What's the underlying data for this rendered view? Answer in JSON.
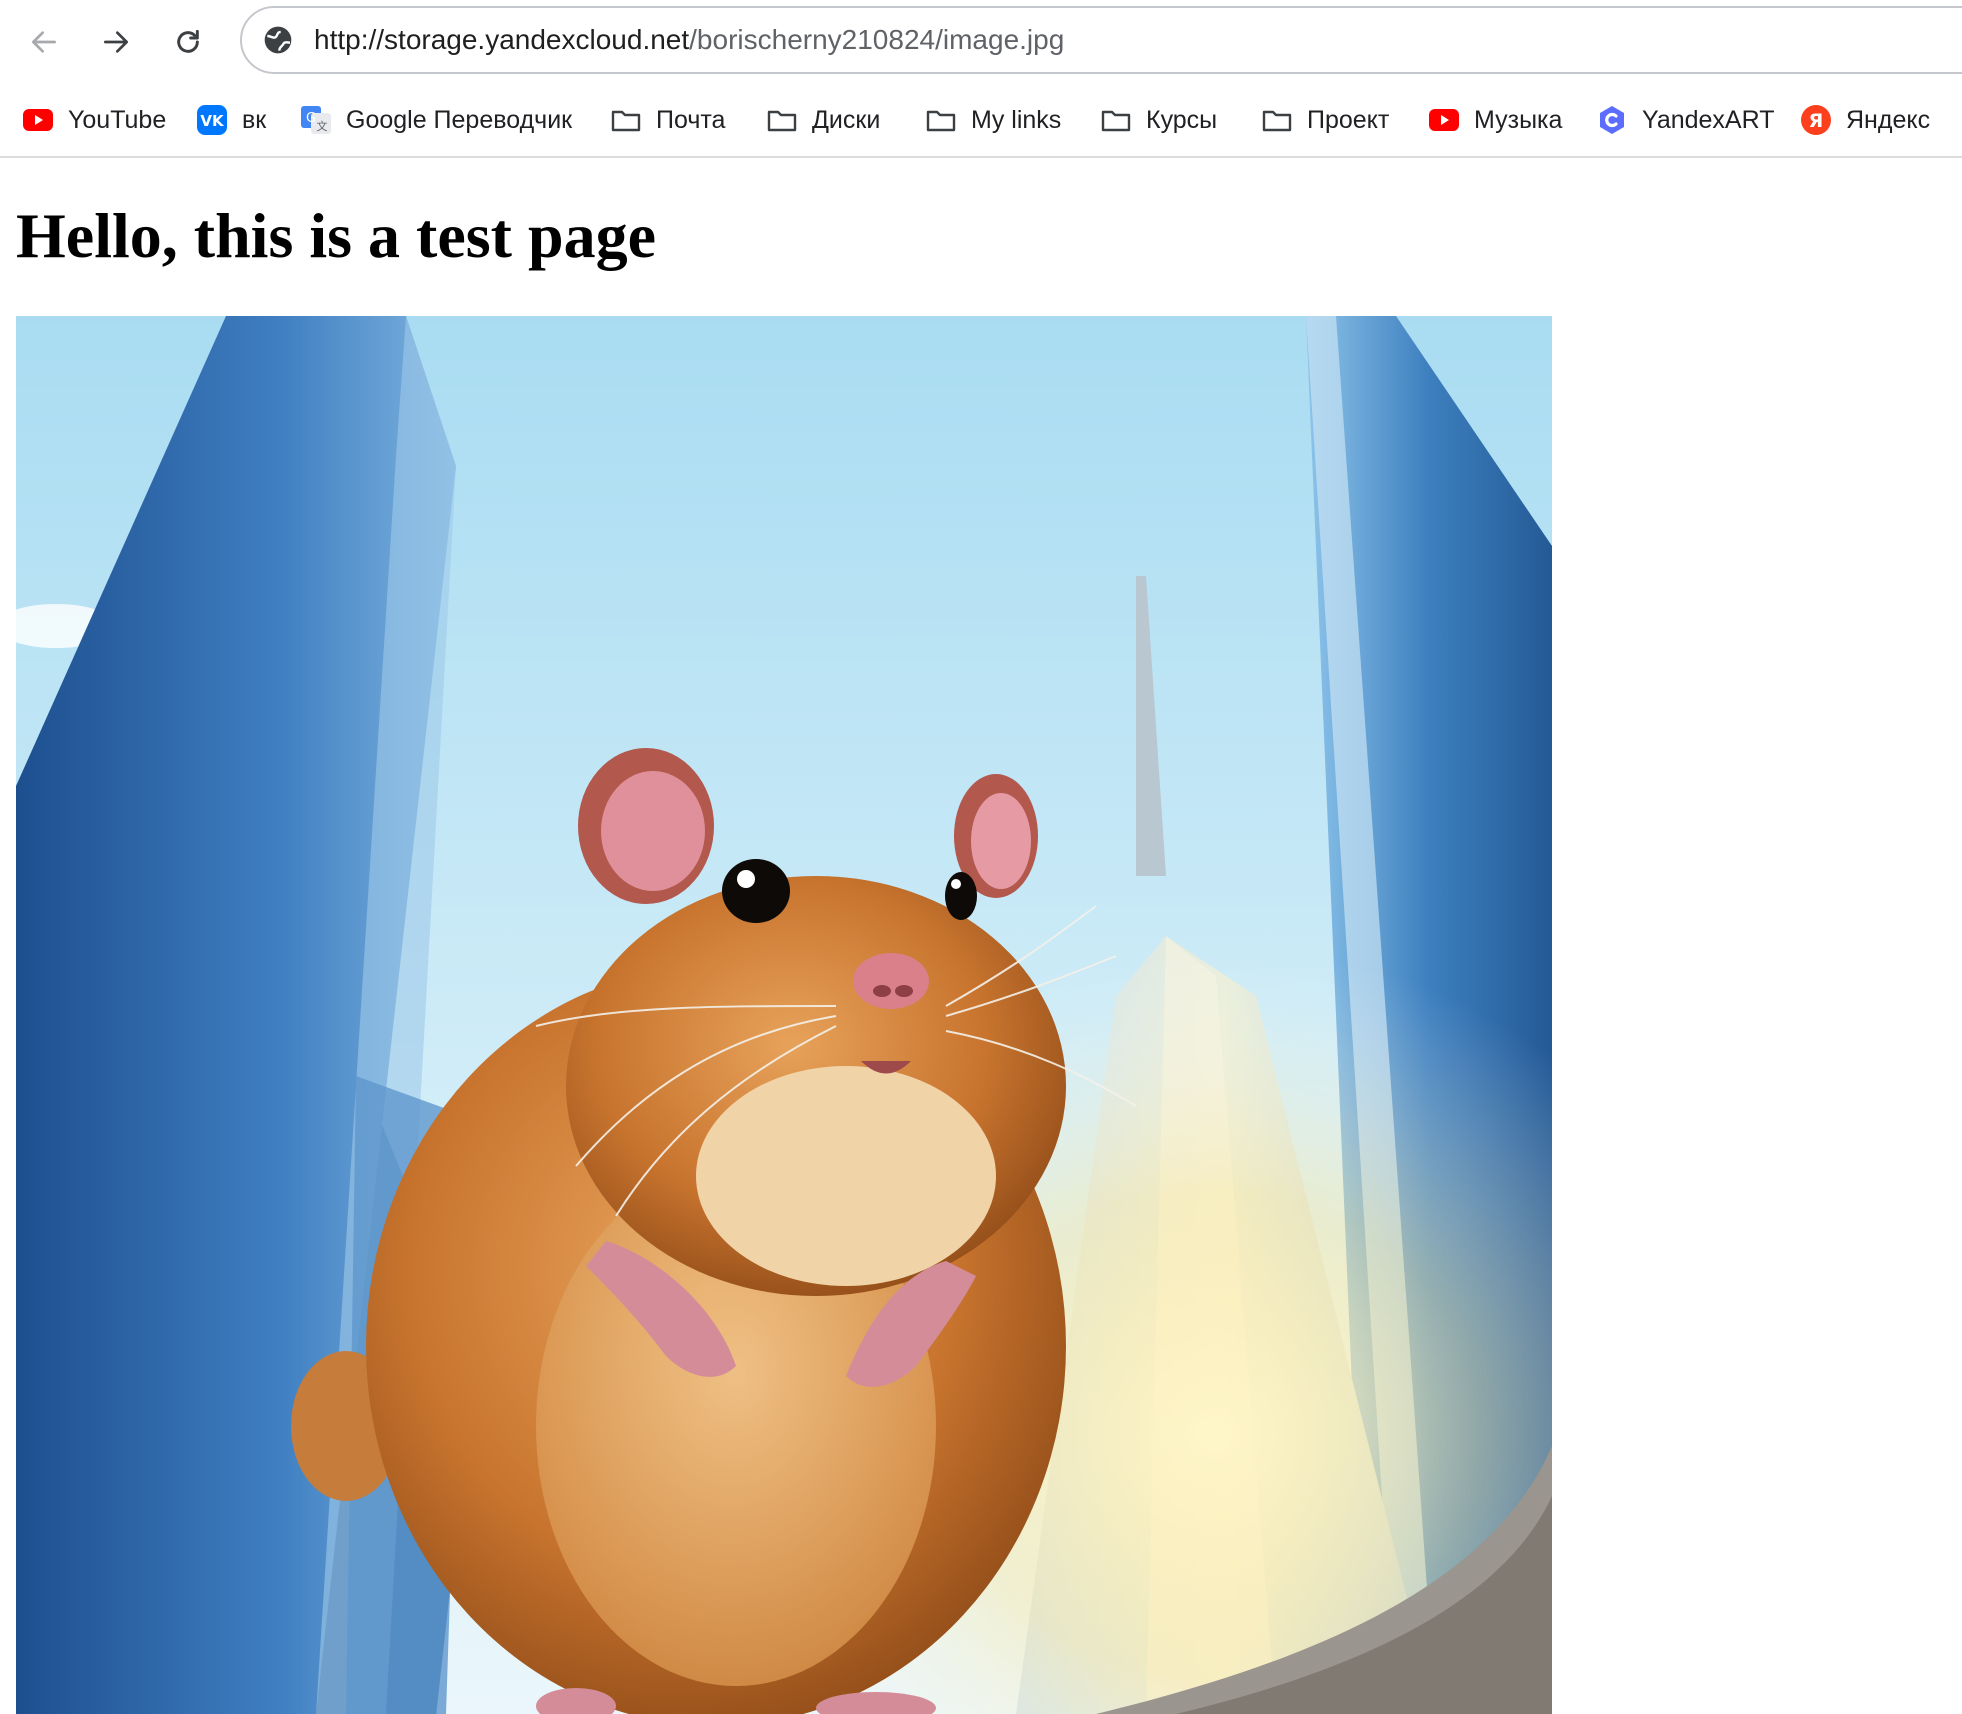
{
  "browser": {
    "url_host": "http://storage.yandexcloud.net",
    "url_path": "/borischerny210824/image.jpg",
    "icons": {
      "back": "arrow-left-icon",
      "forward": "arrow-right-icon",
      "reload": "reload-icon",
      "site": "globe-icon"
    }
  },
  "bookmarks": [
    {
      "label": "YouTube",
      "icon": "youtube-icon"
    },
    {
      "label": "вк",
      "icon": "vk-icon"
    },
    {
      "label": "Google Переводчик",
      "icon": "google-translate-icon"
    },
    {
      "label": "Почта",
      "icon": "folder-icon"
    },
    {
      "label": "Диски",
      "icon": "folder-icon"
    },
    {
      "label": "My links",
      "icon": "folder-icon"
    },
    {
      "label": "Курсы",
      "icon": "folder-icon"
    },
    {
      "label": "Проект",
      "icon": "folder-icon"
    },
    {
      "label": "Музыка",
      "icon": "youtube-icon"
    },
    {
      "label": "YandexART",
      "icon": "yandexart-icon"
    },
    {
      "label": "Яндекс",
      "icon": "yandex-icon"
    }
  ],
  "page": {
    "heading": "Hello, this is a test page"
  },
  "colors": {
    "youtube_red": "#ff0000",
    "vk_blue": "#0077ff",
    "yandex_red": "#fc3f1d",
    "sky": "#bfe3f4",
    "hamster_fur": "#c8742e"
  }
}
